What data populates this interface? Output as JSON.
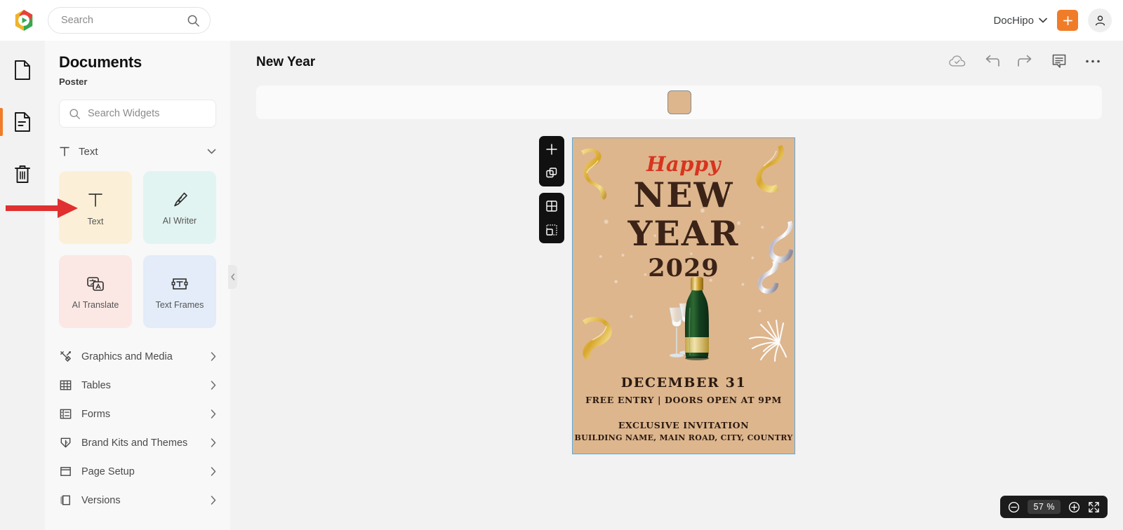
{
  "topbar": {
    "logo_name": "dochipo-logo",
    "search": {
      "placeholder": "Search",
      "value": "",
      "icon": "search-icon"
    },
    "brand": {
      "label": "DocHipo",
      "caret_icon": "chevron-down-icon"
    },
    "create_button": {
      "label": "+",
      "icon": "plus-icon",
      "color": "#f07c28"
    },
    "account": {
      "icon": "user-icon"
    }
  },
  "rail": {
    "items": [
      {
        "name": "documents",
        "icon": "document-icon",
        "active": false
      },
      {
        "name": "templates",
        "icon": "document-lines-icon",
        "active": true
      },
      {
        "name": "trash",
        "icon": "trash-icon",
        "active": false
      }
    ],
    "active_color": "#f07c28"
  },
  "panel": {
    "title": "Documents",
    "subtitle": "Poster",
    "search": {
      "placeholder": "Search Widgets",
      "value": "",
      "icon": "search-icon"
    },
    "section": {
      "label": "Text",
      "icon": "text-t-icon",
      "chevron": "chevron-down-icon",
      "expanded": true
    },
    "cards": [
      {
        "label": "Text",
        "icon": "text-t-icon",
        "bg": "#fbf0d7",
        "selected": true
      },
      {
        "label": "AI Writer",
        "icon": "pen-nib-icon",
        "bg": "#e2f4f1",
        "selected": false
      },
      {
        "label": "AI Translate",
        "icon": "translate-icon",
        "bg": "#fbe8e4",
        "selected": false
      },
      {
        "label": "Text Frames",
        "icon": "text-frame-icon",
        "bg": "#e3ecf8",
        "selected": false
      }
    ],
    "menu": [
      {
        "label": "Graphics and Media",
        "icon": "graphics-media-icon",
        "chevron": "chevron-right-icon"
      },
      {
        "label": "Tables",
        "icon": "table-grid-icon",
        "chevron": "chevron-right-icon"
      },
      {
        "label": "Forms",
        "icon": "forms-icon",
        "chevron": "chevron-right-icon"
      },
      {
        "label": "Brand Kits and Themes",
        "icon": "brand-shield-icon",
        "chevron": "chevron-right-icon"
      },
      {
        "label": "Page Setup",
        "icon": "page-setup-icon",
        "chevron": "chevron-right-icon"
      },
      {
        "label": "Versions",
        "icon": "versions-icon",
        "chevron": "chevron-right-icon"
      }
    ],
    "collapse": {
      "icon": "chevron-left-icon"
    }
  },
  "editor": {
    "document_title": "New Year",
    "tools": [
      {
        "name": "cloud-saved",
        "icon": "cloud-check-icon"
      },
      {
        "name": "undo",
        "icon": "undo-arrow-icon"
      },
      {
        "name": "redo",
        "icon": "redo-arrow-icon"
      },
      {
        "name": "comments",
        "icon": "comment-box-icon"
      },
      {
        "name": "more-options",
        "icon": "ellipsis-icon"
      }
    ],
    "property_bar": {
      "swatch_color": "#ddb68e",
      "swatch_name": "page-background-color"
    },
    "page_tools": [
      {
        "name": "add-page",
        "icon": "plus-icon"
      },
      {
        "name": "duplicate-page",
        "icon": "duplicate-icon"
      },
      {
        "name": "grid-layout",
        "icon": "grid-icon"
      },
      {
        "name": "resize-page",
        "icon": "dashed-resize-icon"
      }
    ],
    "zoom": {
      "value": "57",
      "unit": "%",
      "zoom_out_icon": "minus-circle-icon",
      "zoom_in_icon": "plus-circle-icon",
      "fit_icon": "fullscreen-icon"
    }
  },
  "poster": {
    "background_color": "#ddb68e",
    "selection_color": "#5aa9e0",
    "happy": "Happy",
    "new": "NEW",
    "year": "YEAR",
    "y2029": "2029",
    "date": "DECEMBER 31",
    "entry": "FREE ENTRY  |  DOORS OPEN AT 9PM",
    "exclusive": "EXCLUSIVE INVITATION",
    "address": "BUILDING NAME, MAIN ROAD, CITY, COUNTRY",
    "decor": [
      "gold-ribbon-top-left",
      "gold-ribbon-top-right",
      "gold-ribbon-left",
      "silver-ribbon-right",
      "champagne-bottle-and-glasses",
      "firework-burst"
    ],
    "accent_red": "#d8341f",
    "text_brown": "#3b2317"
  },
  "annotation": {
    "arrow_color": "#e03030",
    "points_to": "text-widget-card"
  }
}
